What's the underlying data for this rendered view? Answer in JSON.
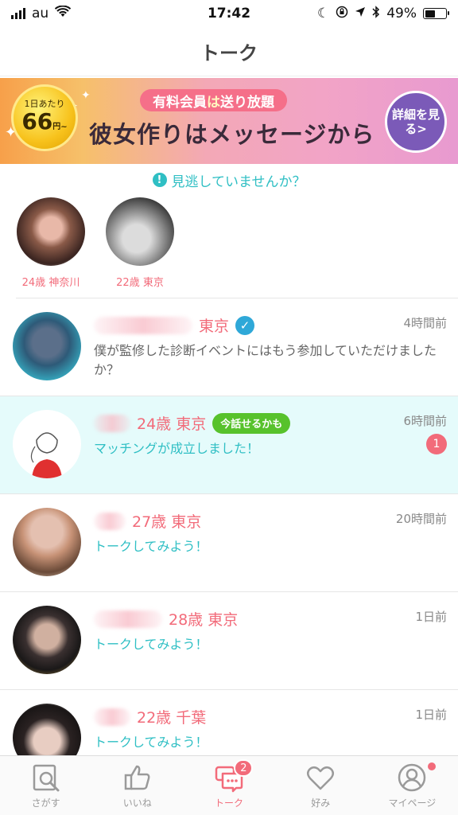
{
  "status": {
    "carrier": "au",
    "time": "17:42",
    "battery_percent": "49%",
    "battery_level": 0.49
  },
  "header": {
    "title": "トーク"
  },
  "banner": {
    "badge_small": "1日あたり",
    "badge_price": "66",
    "badge_unit": "円~",
    "tag_prefix": "有料会員",
    "tag_highlight": "は",
    "tag_suffix": "送り放題",
    "headline": "彼女作りはメッセージから",
    "cta": "詳細を見る>"
  },
  "missed": {
    "heading": "見逃していませんか？",
    "items": [
      {
        "label": "24歳 神奈川"
      },
      {
        "label": "22歳 東京"
      }
    ]
  },
  "chats": [
    {
      "age_location": "東京",
      "time": "4時間前",
      "message": "僕が監修した診断イベントにはもう参加していただけましたか？",
      "verified": true
    },
    {
      "age_location": "24歳 東京",
      "badge": "今話せるかも",
      "time": "6時間前",
      "message": "マッチングが成立しました！",
      "unread": "1"
    },
    {
      "age_location": "27歳 東京",
      "time": "20時間前",
      "message": "トークしてみよう！"
    },
    {
      "age_location": "28歳 東京",
      "time": "1日前",
      "message": "トークしてみよう！"
    },
    {
      "age_location": "22歳 千葉",
      "time": "1日前",
      "message": "トークしてみよう！"
    }
  ],
  "tabs": [
    {
      "label": "さがす",
      "icon": "search-card-icon"
    },
    {
      "label": "いいね",
      "icon": "thumbs-up-icon"
    },
    {
      "label": "トーク",
      "icon": "chat-icon",
      "badge": "2"
    },
    {
      "label": "好み",
      "icon": "heart-icon"
    },
    {
      "label": "マイページ",
      "icon": "profile-icon"
    }
  ],
  "colors": {
    "accent_pink": "#f26b7a",
    "accent_teal": "#2fbfc4",
    "verified_blue": "#2fa8d8",
    "talk_green": "#57c22c"
  }
}
